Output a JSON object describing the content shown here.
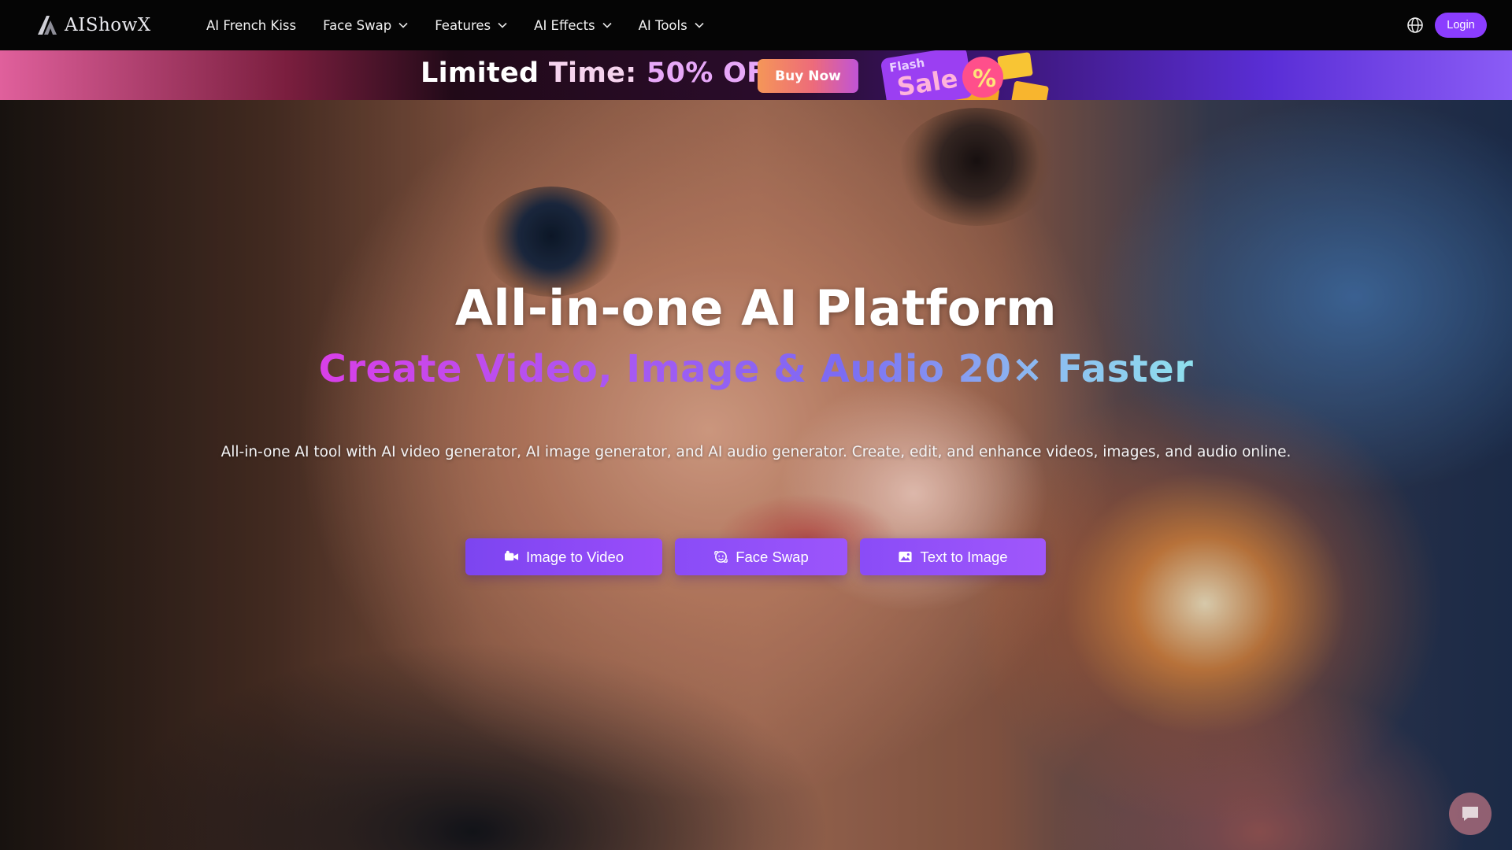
{
  "brand": {
    "name": "AIShowX"
  },
  "nav": {
    "items": [
      {
        "label": "AI French Kiss",
        "has_dropdown": false
      },
      {
        "label": "Face Swap",
        "has_dropdown": true
      },
      {
        "label": "Features",
        "has_dropdown": true
      },
      {
        "label": "AI Effects",
        "has_dropdown": true
      },
      {
        "label": "AI Tools",
        "has_dropdown": true
      }
    ],
    "language_icon": "globe-icon",
    "login_label": "Login"
  },
  "promo": {
    "text_part1": "Limited ",
    "text_part2": "Time: ",
    "text_part3": "50% OFF",
    "buy_label": "Buy Now",
    "badge_text": "Flash",
    "badge_sale": "Sale",
    "badge_percent": "%"
  },
  "hero": {
    "title": "All-in-one AI Platform",
    "subtitle": "Create Video, Image & Audio 20× Faster",
    "description": "All-in-one AI tool with AI video generator, AI image generator, and AI audio generator. Create, edit, and enhance videos, images, and audio online.",
    "buttons": [
      {
        "label": "Image to Video",
        "icon": "video-camera-icon"
      },
      {
        "label": "Face Swap",
        "icon": "face-swap-icon"
      },
      {
        "label": "Text to Image",
        "icon": "image-icon"
      }
    ]
  },
  "chat": {
    "icon": "chat-bubble-icon"
  },
  "colors": {
    "accent": "#8b3dff",
    "navbar_bg": "#050505",
    "cta_gradient_start": "#7c45f0",
    "cta_gradient_end": "#9a4dfa"
  }
}
